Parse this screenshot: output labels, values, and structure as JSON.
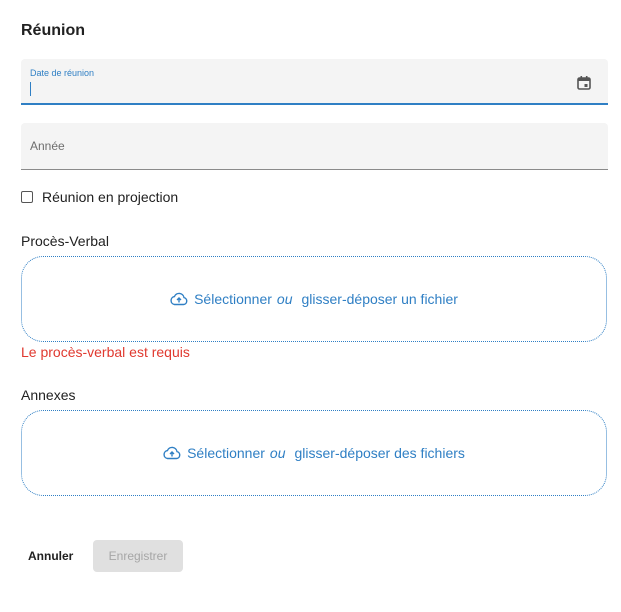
{
  "form": {
    "title": "Réunion",
    "date_field": {
      "label": "Date de réunion",
      "value": "",
      "icon": "calendar-icon"
    },
    "year_field": {
      "label": "Année",
      "value": ""
    },
    "projection_checkbox": {
      "label": "Réunion en projection",
      "checked": false
    },
    "proces_verbal": {
      "label": "Procès-Verbal",
      "select_text": "Sélectionner",
      "or_text": "ou",
      "drop_text": "glisser-déposer un fichier",
      "icon": "cloud-upload-icon",
      "error": "Le procès-verbal est requis"
    },
    "annexes": {
      "label": "Annexes",
      "select_text": "Sélectionner",
      "or_text": "ou",
      "drop_text": "glisser-déposer des fichiers",
      "icon": "cloud-upload-icon"
    },
    "actions": {
      "cancel_label": "Annuler",
      "save_label": "Enregistrer",
      "save_disabled": true
    }
  },
  "colors": {
    "accent": "#2f7fc4",
    "error": "#e0392f",
    "field_bg": "#f4f4f4",
    "disabled_bg": "#e0e0e0",
    "disabled_text": "#a6a6a6"
  }
}
